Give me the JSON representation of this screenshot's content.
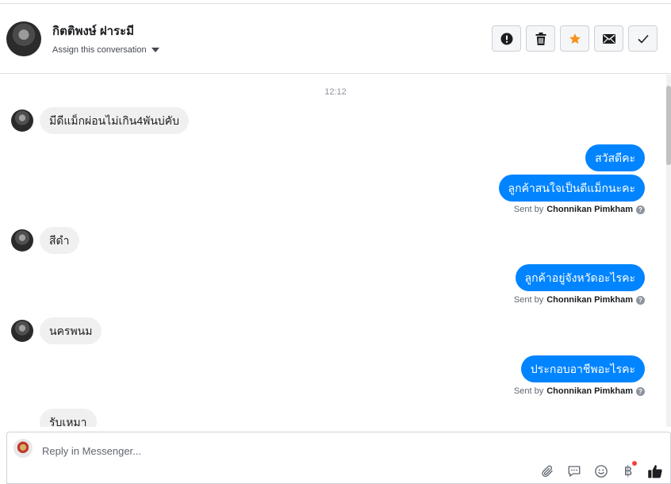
{
  "header": {
    "contact_name": "กิตติพงษ์ ฝาระมี",
    "assign_label": "Assign this conversation",
    "actions": [
      {
        "name": "mark-spam-button",
        "icon": "exclamation-icon"
      },
      {
        "name": "delete-button",
        "icon": "trash-icon"
      },
      {
        "name": "star-button",
        "icon": "star-icon",
        "color": "#f7931e"
      },
      {
        "name": "mark-unread-button",
        "icon": "envelope-icon"
      },
      {
        "name": "mark-done-button",
        "icon": "checkmark-icon"
      }
    ]
  },
  "thread": {
    "timestamp": "12:12",
    "messages": [
      {
        "direction": "in",
        "text": "มีดีแม็กผ่อนไม่เกิน4พันบ่คับ"
      },
      {
        "direction": "out",
        "text": "สวัสดีคะ"
      },
      {
        "direction": "out",
        "text": "ลูกค้าสนใจเป็นดีแม็กนะคะ"
      },
      {
        "direction": "in",
        "text": "สีดำ"
      },
      {
        "direction": "out",
        "text": "ลูกค้าอยู่จังหวัดอะไรคะ"
      },
      {
        "direction": "in",
        "text": "นครพนม"
      },
      {
        "direction": "out",
        "text": "ประกอบอาชีพอะไรคะ"
      },
      {
        "direction": "in",
        "text": "รับเหมา"
      }
    ],
    "sent_by_prefix": "Sent by",
    "sent_by_name": "Chonnikan Pimkham",
    "help_glyph": "?"
  },
  "composer": {
    "placeholder": "Reply in Messenger...",
    "tools": [
      "paperclip-icon",
      "quick-reply-icon",
      "emoji-icon",
      "baht-icon",
      "thumbs-up-icon"
    ],
    "baht_glyph": "฿"
  },
  "colors": {
    "outgoing_bubble": "#0084ff",
    "incoming_bubble": "#f1f0f0",
    "accent_star": "#f7931e"
  }
}
